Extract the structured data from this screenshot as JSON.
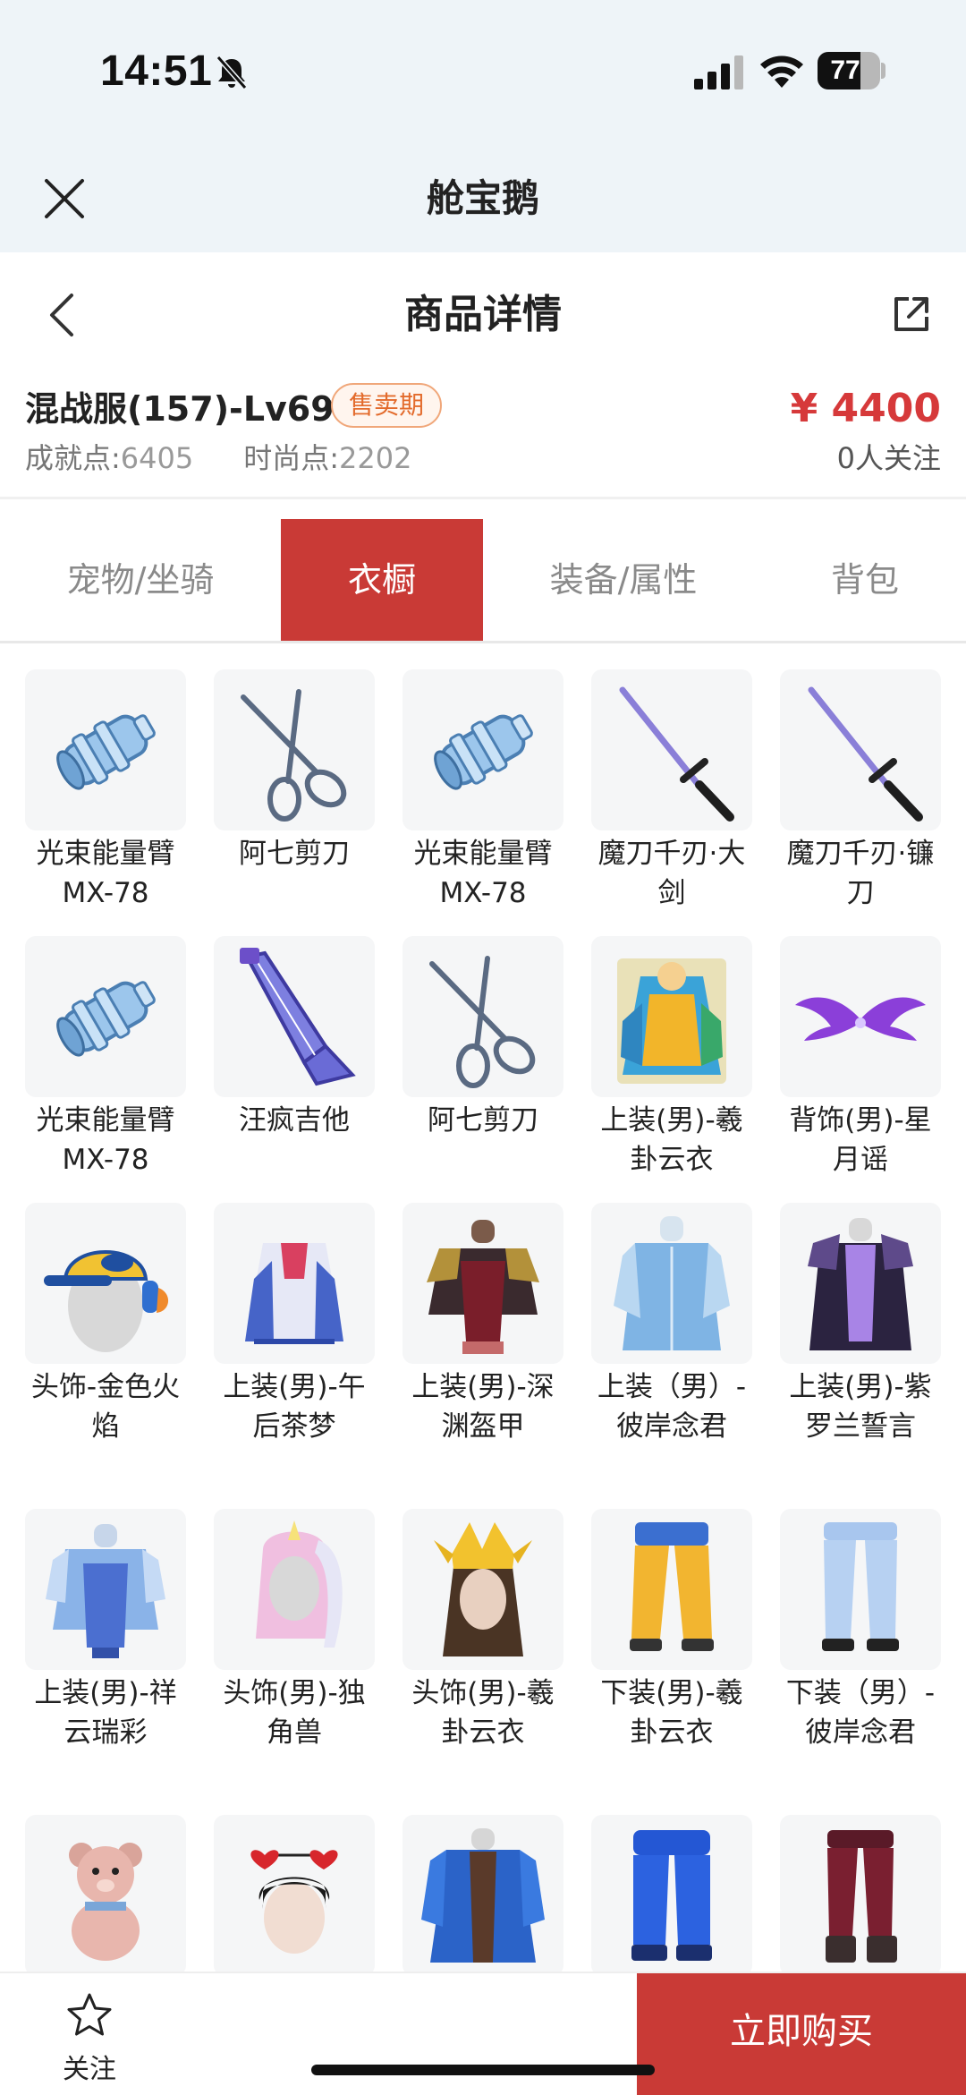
{
  "status_bar": {
    "time": "14:51",
    "battery": "77",
    "battery_level": 0.77
  },
  "mini_app": {
    "title": "舱宝鹅"
  },
  "header": {
    "title": "商品详情"
  },
  "product": {
    "name": "混战服(157)-Lv69",
    "badge": "售卖期",
    "price": "¥ 4400",
    "achievement_label": "成就点:",
    "achievement_value": "6405",
    "fashion_label": "时尚点:",
    "fashion_value": "2202",
    "followers": "0人关注"
  },
  "tabs": [
    {
      "label": "宠物/坐骑",
      "active": false
    },
    {
      "label": "衣橱",
      "active": true
    },
    {
      "label": "装备/属性",
      "active": false
    },
    {
      "label": "背包",
      "active": false
    }
  ],
  "items": [
    {
      "name": "光束能量臂MX-78",
      "icon": "arm-cannon"
    },
    {
      "name": "阿七剪刀",
      "icon": "scissors"
    },
    {
      "name": "光束能量臂MX-78",
      "icon": "arm-cannon"
    },
    {
      "name": "魔刀千刃·大剑",
      "icon": "sword"
    },
    {
      "name": "魔刀千刃·镰刀",
      "icon": "sword"
    },
    {
      "name": "光束能量臂MX-78",
      "icon": "arm-cannon"
    },
    {
      "name": "汪疯吉他",
      "icon": "guitar"
    },
    {
      "name": "阿七剪刀",
      "icon": "scissors"
    },
    {
      "name": "上装(男)-羲卦云衣",
      "icon": "costume"
    },
    {
      "name": "背饰(男)-星月谣",
      "icon": "wings"
    },
    {
      "name": "头饰-金色火焰",
      "icon": "cap-head"
    },
    {
      "name": "上装(男)-午后茶梦",
      "icon": "cape"
    },
    {
      "name": "上装(男)-深渊盔甲",
      "icon": "armor"
    },
    {
      "name": "上装（男）-彼岸念君",
      "icon": "robe"
    },
    {
      "name": "上装(男)-紫罗兰誓言",
      "icon": "coat"
    },
    {
      "name": "上装(男)-祥云瑞彩",
      "icon": "armor-blue"
    },
    {
      "name": "头饰(男)-独角兽",
      "icon": "unicorn-head"
    },
    {
      "name": "头饰(男)-羲卦云衣",
      "icon": "crown-head"
    },
    {
      "name": "下装(男)-羲卦云衣",
      "icon": "pants-yellow"
    },
    {
      "name": "下装（男）-彼岸念君",
      "icon": "pants-blue"
    },
    {
      "name": "",
      "icon": "teddy-bear"
    },
    {
      "name": "",
      "icon": "heart-head"
    },
    {
      "name": "",
      "icon": "robe-blue"
    },
    {
      "name": "",
      "icon": "pants-royal"
    },
    {
      "name": "",
      "icon": "pants-maroon"
    }
  ],
  "bottom_bar": {
    "follow_label": "关注",
    "buy_label": "立即购买"
  },
  "colors": {
    "accent": "#c93a36",
    "price": "#d6393a",
    "badge": "#e36b2c",
    "top_bg": "#eef4f8"
  }
}
